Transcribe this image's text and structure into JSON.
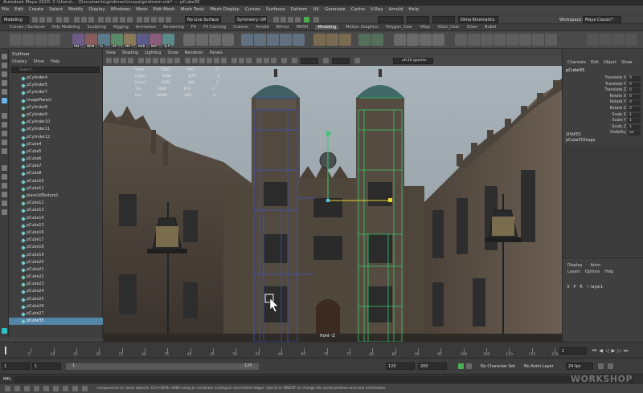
{
  "title": "Autodesk Maya 2020: C:\\Users\\... \\Documents\\gridmom\\maya\\gridmom.mb* --- pCube35",
  "menubar": [
    "File",
    "Edit",
    "Create",
    "Select",
    "Modify",
    "Display",
    "Windows",
    "Mesh",
    "Edit Mesh",
    "Mesh Tools",
    "Mesh Display",
    "Curves",
    "Surfaces",
    "Deform",
    "UV",
    "Generate",
    "Cache",
    "V-Ray",
    "Arnold",
    "Help"
  ],
  "status": {
    "mode": "Modeling",
    "live": "No Live Surface",
    "symmetry": "Symmetry: Off",
    "kinematic": "Dima Kinematics",
    "workspace_label": "Workspace:",
    "workspace": "Maya Classic*"
  },
  "shelf_tabs": [
    "Curves / Surfaces",
    "Poly Modeling",
    "Sculpting",
    "Rigging",
    "Animation",
    "Rendering",
    "FX",
    "FX Caching",
    "Custom",
    "Arnold",
    "Bifrost",
    "MASH",
    "Modeling",
    "Motion Graphics",
    "Polygon_User",
    "VRay",
    "XGen_User",
    "XGen",
    "Bullet"
  ],
  "shelf_active": "Modeling",
  "shelf_labels": [
    "RM",
    "NRM",
    "SL",
    "BP",
    "MR",
    "NSB",
    "MAT",
    "SLP"
  ],
  "outliner": {
    "title": "Outliner",
    "menu": [
      "Display",
      "Show",
      "Help"
    ],
    "search": "Search...",
    "items": [
      "pCylinder4",
      "pCylinder5",
      "pCylinder7",
      "imagePlane2",
      "pCylinder8",
      "pCylinder9",
      "pCylinder10",
      "pCylinder11",
      "pCylinder12",
      "pCube4",
      "pCube5",
      "pCube6",
      "pCube7",
      "pCube8",
      "pCube10",
      "pCube11",
      "place3dTexture1",
      "pCube12",
      "pCube13",
      "pCube14",
      "pCube15",
      "pCube16",
      "pCube17",
      "pCube18",
      "pCube19",
      "pCube20",
      "pCube21",
      "pCube22",
      "pCube23",
      "pCube24",
      "pCube25",
      "pCube26",
      "pCube27",
      "pCube35"
    ],
    "selected": "pCube35"
  },
  "viewport": {
    "menu": [
      "View",
      "Shading",
      "Lighting",
      "Show",
      "Renderer",
      "Panels"
    ],
    "camera": "ufc16 gaaims",
    "camera_label": "front -Z",
    "hud": [
      [
        "Verts:",
        "5080",
        "440",
        "0"
      ],
      [
        "Edges:",
        "9988",
        "876",
        "0"
      ],
      [
        "Faces:",
        "4920",
        "440",
        "0"
      ],
      [
        "Tris:",
        "9840",
        "878",
        "0"
      ],
      [
        "UVs:",
        "10996",
        "660",
        "0"
      ]
    ]
  },
  "channelbox": {
    "menu": [
      "Channels",
      "Edit",
      "Object",
      "Show"
    ],
    "object": "pCube35",
    "attrs": [
      [
        "Translate X",
        "0"
      ],
      [
        "Translate Y",
        "0"
      ],
      [
        "Translate Z",
        "0"
      ],
      [
        "Rotate X",
        "0"
      ],
      [
        "Rotate Y",
        "0"
      ],
      [
        "Rotate Z",
        "0"
      ],
      [
        "Scale X",
        "1"
      ],
      [
        "Scale Y",
        "1"
      ],
      [
        "Scale Z",
        "1"
      ],
      [
        "Visibility",
        "on"
      ]
    ],
    "shapes_header": "SHAPES",
    "shape": "pCube35Shape"
  },
  "layers": {
    "tabs": [
      "Display",
      "Anim"
    ],
    "menu": [
      "Layers",
      "Options",
      "Help"
    ],
    "layer_flags": [
      "V",
      "P",
      "R"
    ],
    "layer": "layer1"
  },
  "timeline": {
    "ticks": [
      "5",
      "10",
      "15",
      "20",
      "25",
      "30",
      "35",
      "40",
      "45",
      "50",
      "55",
      "60",
      "65",
      "70",
      "75",
      "80",
      "85",
      "90",
      "95",
      "100",
      "105",
      "110",
      "115",
      "120"
    ],
    "current": "1"
  },
  "range": {
    "start": "1",
    "start2": "1",
    "bar_start": "1",
    "bar_end": "120",
    "end": "120",
    "end2": "200",
    "char_set": "No Character Set",
    "anim_layer": "No Anim Layer",
    "fps": "24 fps"
  },
  "mel": "MEL",
  "help": "components or clone objects. Ctrl+Shift+LMB+drag to constrain scaling to connected edges. Use D or INSERT to change the pivot position and axis orientation.",
  "watermark": "WORKSHOP"
}
